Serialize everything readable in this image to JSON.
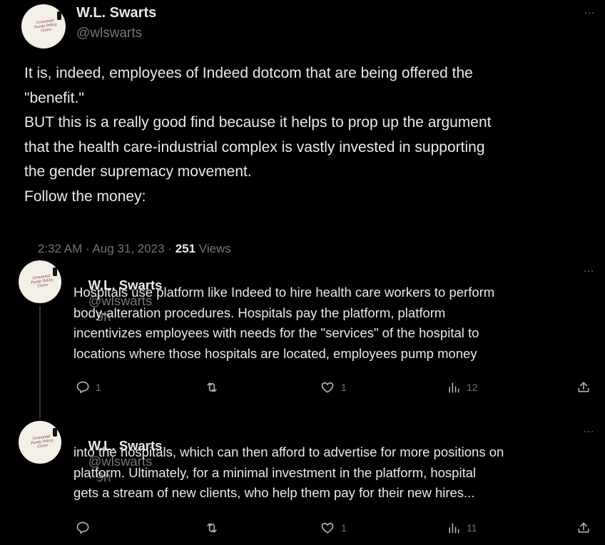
{
  "main_tweet": {
    "author_name": "W.L. Swarts",
    "handle": "@wlswarts",
    "avatar_text": "Unnamed Purdo Policy Claim",
    "text": "It is, indeed, employees of Indeed dotcom that are being offered the\n\"benefit.\"\nBUT this is a really good find because it helps to prop up the argument\nthat the health care-industrial complex is vastly invested in supporting\nthe gender supremacy movement.\nFollow the money:",
    "time": "2:32 AM · Aug 31, 2023 · ",
    "views_count": "251",
    "views_label": " Views",
    "more_icon": "…"
  },
  "replies": [
    {
      "author_name": "W.L. Swarts",
      "handle": "@wlswarts",
      "time_ago": "· 9h",
      "avatar_text": "Unnamed Purdo Policy Claim",
      "text": "Hospitals use platform like Indeed to hire health care workers to perform\nbody-alteration procedures. Hospitals pay the platform, platform\nincentivizes employees with needs for the \"services\" of the hospital to\nlocations where those hospitals are located, employees pump money",
      "reply_count": "1",
      "repost_count": "",
      "like_count": "1",
      "view_count": "12",
      "more_icon": "…"
    },
    {
      "author_name": "W.L. Swarts",
      "handle": "@wlswarts",
      "time_ago": "· 9h",
      "avatar_text": "Unnamed Purdo Policy Claim",
      "text": "into the hospitals, which can then afford to advertise for more positions on\nplatform. Ultimately, for a minimal investment in the platform, hospital\ngets a stream of new clients, who help them pay for their new hires...",
      "reply_count": "",
      "repost_count": "",
      "like_count": "1",
      "view_count": "11",
      "more_icon": "…"
    }
  ],
  "icons": {
    "reply": "reply-icon",
    "repost": "repost-icon",
    "like": "heart-icon",
    "views": "bar-chart-icon",
    "share": "share-icon"
  },
  "colors": {
    "background": "#000000",
    "text": "#e7e9ea",
    "secondary": "#71767b"
  }
}
